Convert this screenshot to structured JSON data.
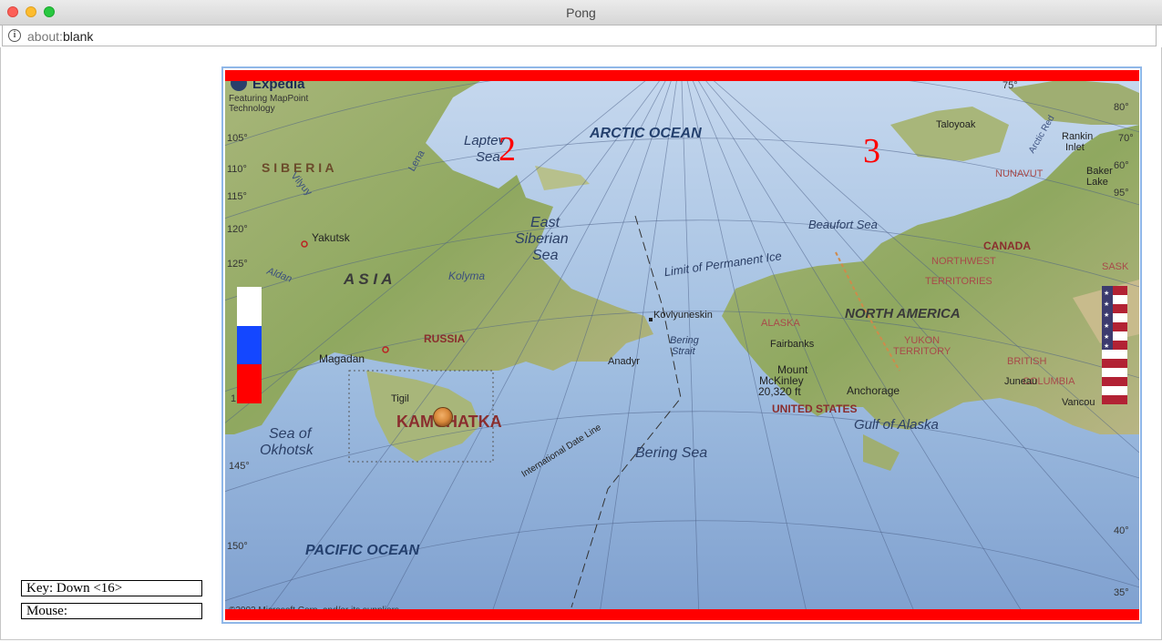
{
  "window": {
    "title": "Pong"
  },
  "address_bar": {
    "scheme": "about:",
    "path": "blank"
  },
  "readouts": {
    "key": "Key: Down <16>",
    "mouse": "Mouse:"
  },
  "game": {
    "scores": {
      "left": "2",
      "right": "3"
    },
    "left_paddle_colors": [
      "#ffffff",
      "#1447ff",
      "#ff0000"
    ],
    "right_paddle_colors": {
      "stripe_red": "#b22234",
      "stripe_white": "#ffffff",
      "canton": "#3c3b6e"
    },
    "wall_color": "#ff0000",
    "map_labels": {
      "brand": "Expedia",
      "brand_sub1": "Featuring MapPoint",
      "brand_sub2": "Technology",
      "arctic": "ARCTIC OCEAN",
      "laptev1": "Laptev",
      "laptev2": "Sea",
      "siberia": "S I B E R I A",
      "lena": "Lena",
      "vilyuy": "Vilyuy",
      "yakutsk": "Yakutsk",
      "aldan": "Aldan",
      "asia": "A S I A",
      "kolyma": "Kolyma",
      "east_sib1": "East",
      "east_sib2": "Siberian",
      "east_sib3": "Sea",
      "beaufort": "Beaufort Sea",
      "ice": "Limit of Permanent Ice",
      "taloyoak": "Taloyoak",
      "rankin1": "Rankin",
      "rankin2": "Inlet",
      "nunavut": "NUNAVUT",
      "baker1": "Baker",
      "baker2": "Lake",
      "arctic_red": "Arctic Red",
      "canada": "CANADA",
      "nwt1": "NORTHWEST",
      "nwt2": "TERRITORIES",
      "sask": "SASK",
      "russia": "RUSSIA",
      "magadan": "Magadan",
      "kovly": "Kovlyuneskin",
      "alaska": "ALASKA",
      "north_america": "NORTH AMERICA",
      "bering1": "Bering",
      "bering2": "Strait",
      "fairbanks": "Fairbanks",
      "yukon1": "YUKON",
      "yukon2": "TERRITORY",
      "british": "BRITISH",
      "columbia": "COLUMBIA",
      "anadyr": "Anadyr",
      "mckinley1": "Mount",
      "mckinley2": "McKinley",
      "mckinley3": "20,320 ft",
      "anchorage": "Anchorage",
      "juneau": "Juneau",
      "vancouver": "Vancou",
      "tigil": "Tigil",
      "us": "UNITED STATES",
      "gulf": "Gulf of Alaska",
      "okhotsk1": "Sea of",
      "okhotsk2": "Okhotsk",
      "kamchatka": "KAMCHATKA",
      "dateline": "International Date Line",
      "bering_sea": "Bering Sea",
      "pacific": "PACIFIC OCEAN",
      "copyright": "©2002 Microsoft Corp. and/or its suppliers",
      "d105": "105°",
      "d110": "110°",
      "d115": "115°",
      "d120": "120°",
      "d125": "125°",
      "d1": "1",
      "d145": "145°",
      "d150": "150°",
      "r75": "75°",
      "r80": "80°",
      "r70": "70°",
      "r60": "60°",
      "r95": "95°",
      "r40": "40°",
      "r35": "35°"
    }
  }
}
